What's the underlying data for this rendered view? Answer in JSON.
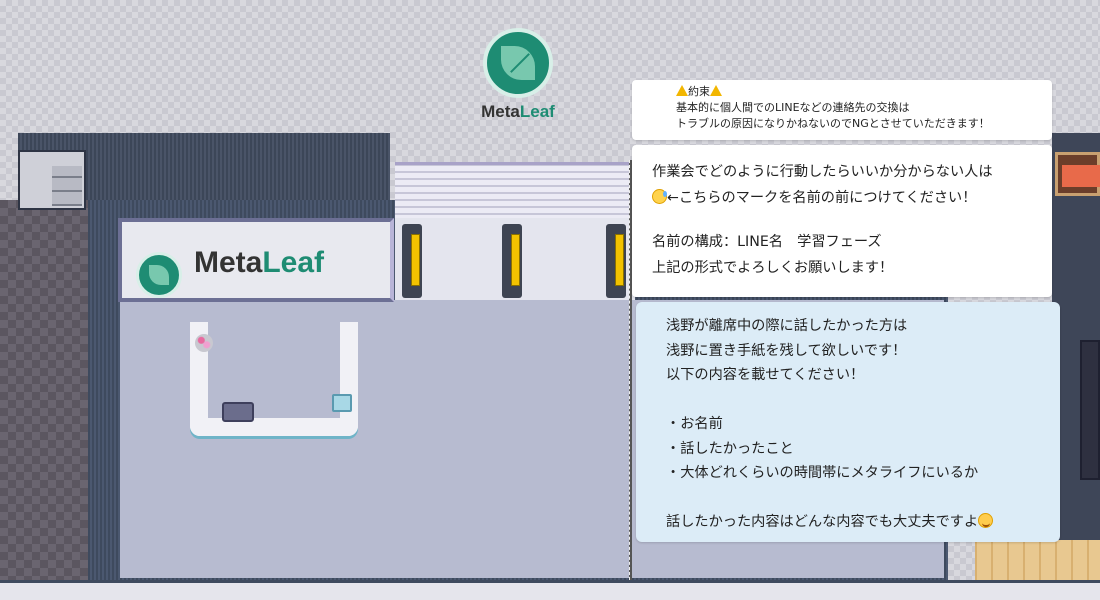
{
  "top_logo": {
    "brand_prefix": "Meta",
    "brand_suffix": "Leaf",
    "icon": "leaf-icon"
  },
  "signboard": {
    "brand_prefix": "Meta",
    "brand_suffix": "Leaf",
    "icon": "leaf-icon"
  },
  "colors": {
    "brand_green": "#1e8c73",
    "note_blue": "#dcecf7",
    "warning_yellow": "#f2b600"
  },
  "note_rules": {
    "title": "約束",
    "warning_icon": "warning-icon",
    "line1": "基本的に個人間でのLINEなどの連絡先の交換は",
    "line2": "トラブルの原因になりかねないのでNGとさせていただきます！"
  },
  "note_howto": {
    "line1": "作業会でどのように行動したらいいか分からない人は",
    "line2_emoji": "sweat-face-icon",
    "line2": "←こちらのマークを名前の前につけてください！",
    "line3": "名前の構成：LINE名　学習フェーズ",
    "line4": "上記の形式でよろしくお願いします！"
  },
  "note_message": {
    "line1": "浅野が離席中の際に話したかった方は",
    "line2": "浅野に置き手紙を残して欲しいです！",
    "line3": "以下の内容を載せてください！",
    "items": [
      "・お名前",
      "・話したかったこと",
      "・大体どれくらいの時間帯にメタライフにいるか"
    ],
    "closing": "話したかった内容はどんな内容でも大丈夫ですよ",
    "closing_emoji": "smiling-face-icon"
  }
}
